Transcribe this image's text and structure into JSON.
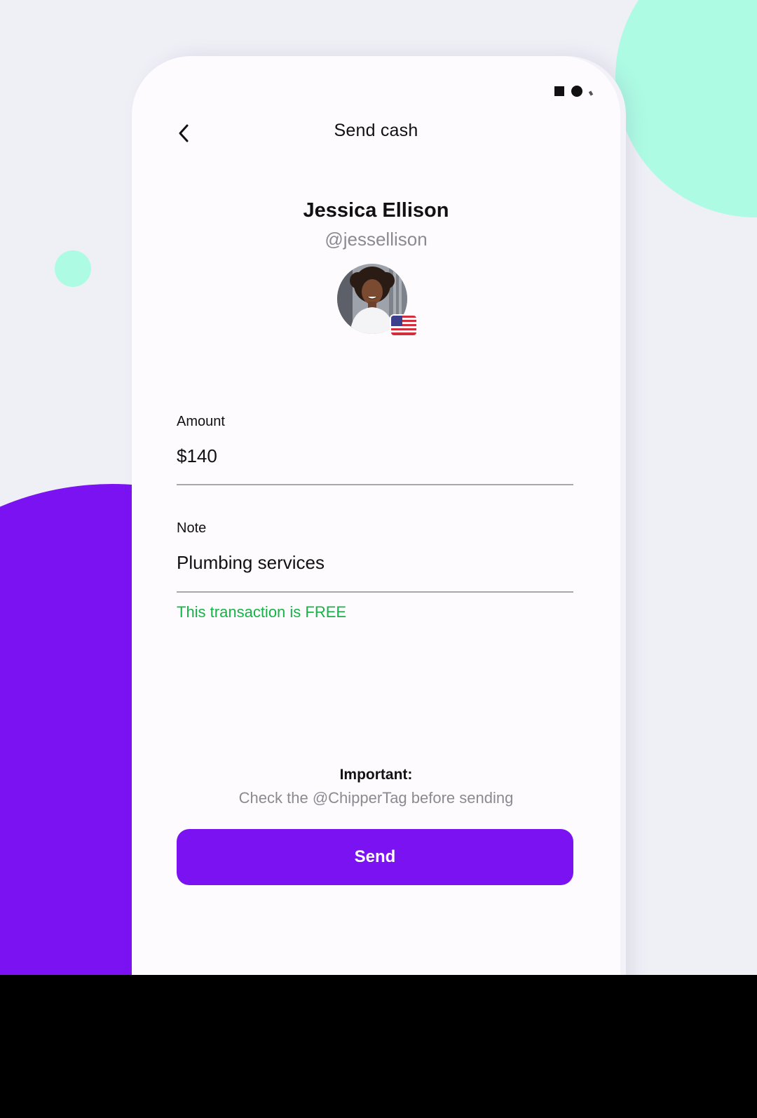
{
  "header": {
    "title": "Send cash",
    "back_icon": "chevron-left-icon"
  },
  "status_bar": {
    "icons": [
      "square-icon",
      "dot-icon",
      "signal-tick-icon"
    ]
  },
  "recipient": {
    "name": "Jessica Ellison",
    "handle": "@jessellison",
    "flag": "us-flag-icon"
  },
  "form": {
    "amount": {
      "label": "Amount",
      "value": "$140"
    },
    "note": {
      "label": "Note",
      "value": "Plumbing services"
    },
    "fee_message": "This transaction is FREE"
  },
  "notice": {
    "label": "Important:",
    "text": "Check the @ChipperTag before sending"
  },
  "actions": {
    "send_label": "Send"
  },
  "colors": {
    "background": "#efeff6",
    "accent_purple": "#7a12f2",
    "accent_mint": "#adfbe3",
    "success_green": "#16b347",
    "muted_gray": "#8a8a90"
  }
}
